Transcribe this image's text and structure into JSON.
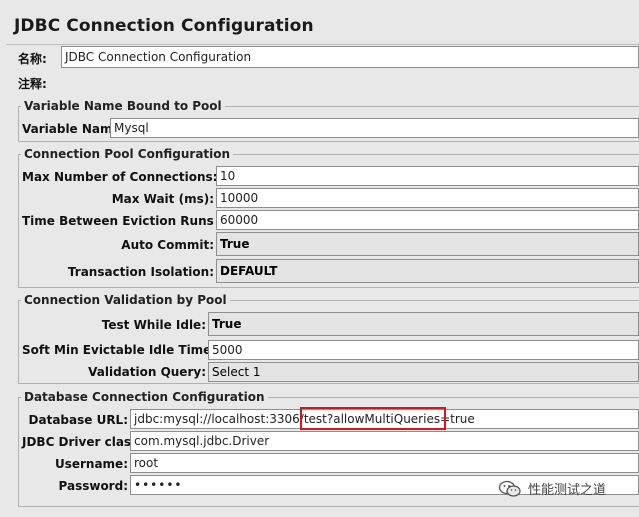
{
  "window": {
    "title": "JDBC Connection Configuration"
  },
  "name": {
    "label": "名称:",
    "value": "JDBC Connection Configuration"
  },
  "comment": {
    "label": "注释:",
    "value": ""
  },
  "pool_binding": {
    "legend": "Variable Name Bound to Pool",
    "variable_name_label": "Variable Name:",
    "variable_name_value": "Mysql"
  },
  "pool_config": {
    "legend": "Connection Pool Configuration",
    "max_connections_label": "Max Number of Connections:",
    "max_connections_value": "10",
    "max_wait_label": "Max Wait (ms):",
    "max_wait_value": "10000",
    "eviction_label": "Time Between Eviction Runs (ms):",
    "eviction_value": "60000",
    "auto_commit_label": "Auto Commit:",
    "auto_commit_value": "True",
    "isolation_label": "Transaction Isolation:",
    "isolation_value": "DEFAULT"
  },
  "validation": {
    "legend": "Connection Validation by Pool",
    "test_idle_label": "Test While Idle:",
    "test_idle_value": "True",
    "soft_min_label": "Soft Min Evictable Idle Time(ms):",
    "soft_min_value": "5000",
    "query_label": "Validation Query:",
    "query_value": "Select 1"
  },
  "database": {
    "legend": "Database Connection Configuration",
    "url_label": "Database URL:",
    "url_value": "jdbc:mysql://localhost:3306/test?allowMultiQueries=true",
    "highlight_text": "?allowMultiQueries=true",
    "driver_label": "JDBC Driver class:",
    "driver_value": "com.mysql.jdbc.Driver",
    "username_label": "Username:",
    "username_value": "root",
    "password_label": "Password:",
    "password_value": "••••••"
  },
  "watermark": {
    "text": "性能测试之道",
    "icon": "wechat-icon"
  },
  "colors": {
    "highlight": "#d8151a",
    "background": "#e8e8e8"
  }
}
